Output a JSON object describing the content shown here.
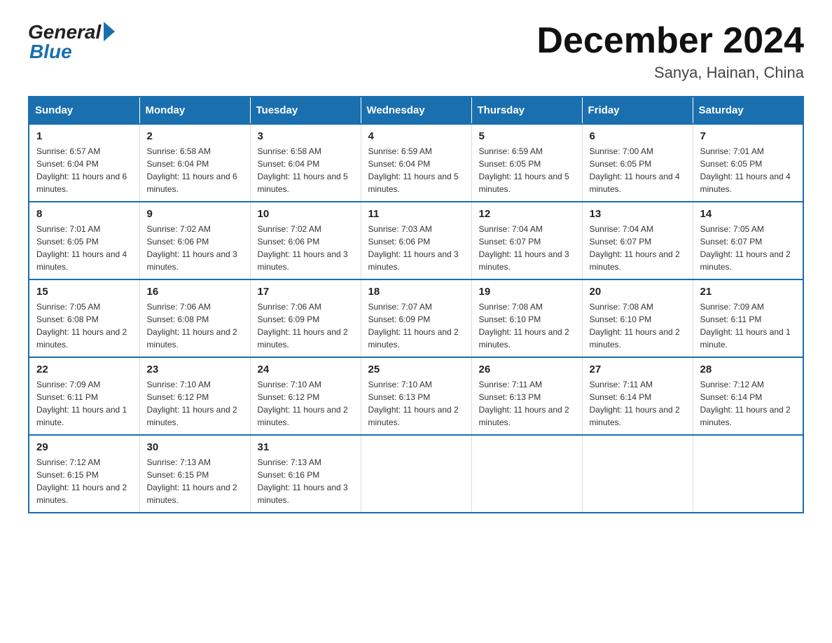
{
  "logo": {
    "general": "General",
    "blue": "Blue"
  },
  "header": {
    "month": "December 2024",
    "location": "Sanya, Hainan, China"
  },
  "days_of_week": [
    "Sunday",
    "Monday",
    "Tuesday",
    "Wednesday",
    "Thursday",
    "Friday",
    "Saturday"
  ],
  "weeks": [
    [
      {
        "day": "1",
        "sunrise": "6:57 AM",
        "sunset": "6:04 PM",
        "daylight": "11 hours and 6 minutes."
      },
      {
        "day": "2",
        "sunrise": "6:58 AM",
        "sunset": "6:04 PM",
        "daylight": "11 hours and 6 minutes."
      },
      {
        "day": "3",
        "sunrise": "6:58 AM",
        "sunset": "6:04 PM",
        "daylight": "11 hours and 5 minutes."
      },
      {
        "day": "4",
        "sunrise": "6:59 AM",
        "sunset": "6:04 PM",
        "daylight": "11 hours and 5 minutes."
      },
      {
        "day": "5",
        "sunrise": "6:59 AM",
        "sunset": "6:05 PM",
        "daylight": "11 hours and 5 minutes."
      },
      {
        "day": "6",
        "sunrise": "7:00 AM",
        "sunset": "6:05 PM",
        "daylight": "11 hours and 4 minutes."
      },
      {
        "day": "7",
        "sunrise": "7:01 AM",
        "sunset": "6:05 PM",
        "daylight": "11 hours and 4 minutes."
      }
    ],
    [
      {
        "day": "8",
        "sunrise": "7:01 AM",
        "sunset": "6:05 PM",
        "daylight": "11 hours and 4 minutes."
      },
      {
        "day": "9",
        "sunrise": "7:02 AM",
        "sunset": "6:06 PM",
        "daylight": "11 hours and 3 minutes."
      },
      {
        "day": "10",
        "sunrise": "7:02 AM",
        "sunset": "6:06 PM",
        "daylight": "11 hours and 3 minutes."
      },
      {
        "day": "11",
        "sunrise": "7:03 AM",
        "sunset": "6:06 PM",
        "daylight": "11 hours and 3 minutes."
      },
      {
        "day": "12",
        "sunrise": "7:04 AM",
        "sunset": "6:07 PM",
        "daylight": "11 hours and 3 minutes."
      },
      {
        "day": "13",
        "sunrise": "7:04 AM",
        "sunset": "6:07 PM",
        "daylight": "11 hours and 2 minutes."
      },
      {
        "day": "14",
        "sunrise": "7:05 AM",
        "sunset": "6:07 PM",
        "daylight": "11 hours and 2 minutes."
      }
    ],
    [
      {
        "day": "15",
        "sunrise": "7:05 AM",
        "sunset": "6:08 PM",
        "daylight": "11 hours and 2 minutes."
      },
      {
        "day": "16",
        "sunrise": "7:06 AM",
        "sunset": "6:08 PM",
        "daylight": "11 hours and 2 minutes."
      },
      {
        "day": "17",
        "sunrise": "7:06 AM",
        "sunset": "6:09 PM",
        "daylight": "11 hours and 2 minutes."
      },
      {
        "day": "18",
        "sunrise": "7:07 AM",
        "sunset": "6:09 PM",
        "daylight": "11 hours and 2 minutes."
      },
      {
        "day": "19",
        "sunrise": "7:08 AM",
        "sunset": "6:10 PM",
        "daylight": "11 hours and 2 minutes."
      },
      {
        "day": "20",
        "sunrise": "7:08 AM",
        "sunset": "6:10 PM",
        "daylight": "11 hours and 2 minutes."
      },
      {
        "day": "21",
        "sunrise": "7:09 AM",
        "sunset": "6:11 PM",
        "daylight": "11 hours and 1 minute."
      }
    ],
    [
      {
        "day": "22",
        "sunrise": "7:09 AM",
        "sunset": "6:11 PM",
        "daylight": "11 hours and 1 minute."
      },
      {
        "day": "23",
        "sunrise": "7:10 AM",
        "sunset": "6:12 PM",
        "daylight": "11 hours and 2 minutes."
      },
      {
        "day": "24",
        "sunrise": "7:10 AM",
        "sunset": "6:12 PM",
        "daylight": "11 hours and 2 minutes."
      },
      {
        "day": "25",
        "sunrise": "7:10 AM",
        "sunset": "6:13 PM",
        "daylight": "11 hours and 2 minutes."
      },
      {
        "day": "26",
        "sunrise": "7:11 AM",
        "sunset": "6:13 PM",
        "daylight": "11 hours and 2 minutes."
      },
      {
        "day": "27",
        "sunrise": "7:11 AM",
        "sunset": "6:14 PM",
        "daylight": "11 hours and 2 minutes."
      },
      {
        "day": "28",
        "sunrise": "7:12 AM",
        "sunset": "6:14 PM",
        "daylight": "11 hours and 2 minutes."
      }
    ],
    [
      {
        "day": "29",
        "sunrise": "7:12 AM",
        "sunset": "6:15 PM",
        "daylight": "11 hours and 2 minutes."
      },
      {
        "day": "30",
        "sunrise": "7:13 AM",
        "sunset": "6:15 PM",
        "daylight": "11 hours and 2 minutes."
      },
      {
        "day": "31",
        "sunrise": "7:13 AM",
        "sunset": "6:16 PM",
        "daylight": "11 hours and 3 minutes."
      },
      null,
      null,
      null,
      null
    ]
  ],
  "labels": {
    "sunrise": "Sunrise:",
    "sunset": "Sunset:",
    "daylight": "Daylight:"
  },
  "accent_color": "#1a6faf"
}
